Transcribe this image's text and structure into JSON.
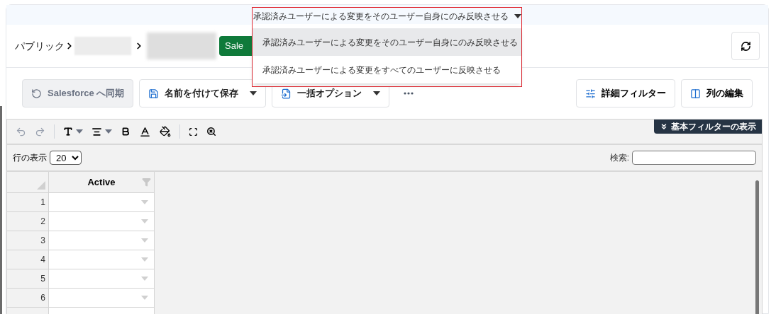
{
  "breadcrumb": {
    "items": [
      "パブリック"
    ],
    "badge": "Sale"
  },
  "sync_dropdown": {
    "value": "承認済みユーザーによる変更をそのユーザー自身にのみ反映させる",
    "expanded": true,
    "options": [
      {
        "label": "承認済みユーザーによる変更をそのユーザー自身にのみ反映させる",
        "selected": true
      },
      {
        "label": "承認済みユーザーによる変更をすべてのユーザーに反映させる",
        "selected": false
      }
    ]
  },
  "toolbar": [
    {
      "kind": "sync",
      "label": "Salesforce へ同期",
      "disabled": true
    },
    {
      "kind": "save",
      "label": "名前を付けて保存",
      "disabled": false
    },
    {
      "kind": "bulk",
      "label": "一括オプション",
      "disabled": false
    },
    {
      "kind": "more"
    }
  ],
  "right_toolbar": [
    {
      "kind": "filter",
      "label": "詳細フィルター"
    },
    {
      "kind": "columns",
      "label": "列の編集"
    }
  ],
  "filter_toggle": "基本フィルターの表示",
  "rows_display": {
    "label": "行の表示",
    "value": "20"
  },
  "search": {
    "label": "検索:"
  },
  "table": {
    "columns": [
      "Active"
    ],
    "rows": [
      "1",
      "2",
      "3",
      "4",
      "5",
      "6"
    ]
  }
}
